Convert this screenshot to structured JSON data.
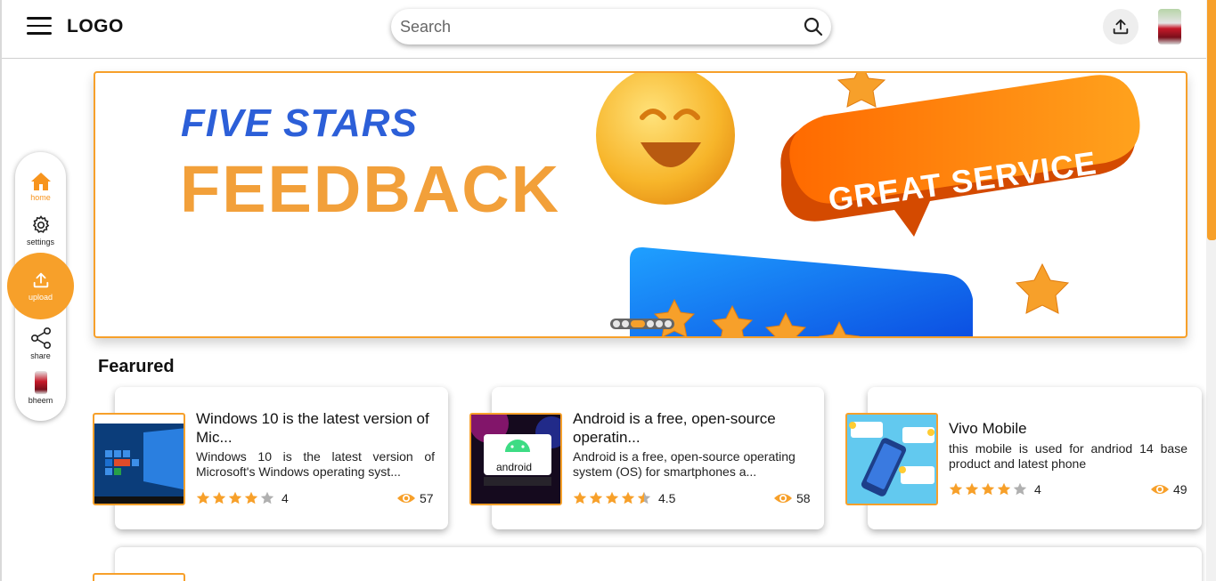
{
  "header": {
    "logo": "LOGO",
    "search_placeholder": "Search",
    "icons": {
      "menu": "hamburger-icon",
      "search": "search-icon",
      "upload": "upload-icon"
    }
  },
  "sidebar": {
    "items": [
      {
        "label": "home",
        "icon": "home-icon",
        "active": true
      },
      {
        "label": "settings",
        "icon": "gear-icon"
      },
      {
        "label": "upload",
        "icon": "upload-icon"
      },
      {
        "label": "share",
        "icon": "share-icon"
      },
      {
        "label": "bheem",
        "icon": "avatar"
      }
    ],
    "accent": "#f7a02a"
  },
  "banner": {
    "line1": "FIVE STARS",
    "line2": "FEEDBACK",
    "bubble": "GREAT SERVICE",
    "slides": 6,
    "active_slide": 3
  },
  "section": {
    "title": "Fearured"
  },
  "cards": [
    {
      "title": "Windows 10 is the latest version of Mic...",
      "description": "Windows 10 is the latest version of Microsoft's Windows operating syst...",
      "rating": "4",
      "rating_value": 4,
      "views": "57",
      "thumb": "windows-desktop"
    },
    {
      "title": "Android is a free, open-source operatin...",
      "description": "Android is a free, open-source operating system (OS) for smartphones a...",
      "rating": "4.5",
      "rating_value": 4.5,
      "views": "58",
      "thumb": "android-phone",
      "thumb_text": "android"
    },
    {
      "title": "Vivo Mobile",
      "description": "this mobile is used for andriod 14 base product and latest phone",
      "rating": "4",
      "rating_value": 4,
      "views": "49",
      "thumb": "phone-chat"
    }
  ],
  "colors": {
    "accent": "#f7a02a",
    "blue": "#2c5fd8",
    "star": "#f7a02a",
    "star_empty": "#b0b0b0"
  }
}
